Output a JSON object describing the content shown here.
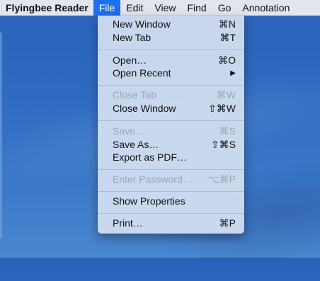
{
  "menubar": {
    "app_name": "Flyingbee Reader",
    "items": [
      "File",
      "Edit",
      "View",
      "Find",
      "Go",
      "Annotation"
    ]
  },
  "file_menu": {
    "new_window": {
      "label": "New Window",
      "shortcut": "⌘N"
    },
    "new_tab": {
      "label": "New Tab",
      "shortcut": "⌘T"
    },
    "open": {
      "label": "Open…",
      "shortcut": "⌘O"
    },
    "open_recent": {
      "label": "Open Recent",
      "shortcut": "▶"
    },
    "close_tab": {
      "label": "Close Tab",
      "shortcut": "⌘W"
    },
    "close_window": {
      "label": "Close Window",
      "shortcut": "⇧⌘W"
    },
    "save": {
      "label": "Save…",
      "shortcut": "⌘S"
    },
    "save_as": {
      "label": "Save As…",
      "shortcut": "⇧⌘S"
    },
    "export_pdf": {
      "label": "Export as PDF…",
      "shortcut": ""
    },
    "enter_password": {
      "label": "Enter Password…",
      "shortcut": "⌥⌘P"
    },
    "show_properties": {
      "label": "Show Properties",
      "shortcut": ""
    },
    "print": {
      "label": "Print…",
      "shortcut": "⌘P"
    }
  },
  "colors": {
    "accent": "#1e6ff0",
    "menu_bg": "#cddbee",
    "disabled_text": "#9fa6b2"
  }
}
